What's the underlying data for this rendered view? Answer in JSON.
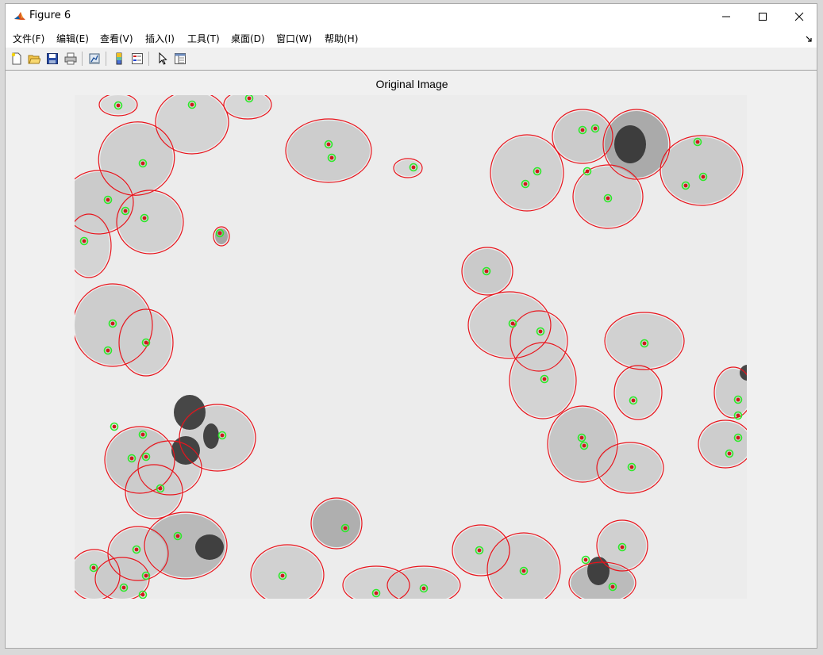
{
  "window": {
    "title": "Figure 6",
    "controls": {
      "minimize": "minimize-icon",
      "maximize": "maximize-icon",
      "close": "close-icon"
    }
  },
  "menu": [
    "文件(F)",
    "编辑(E)",
    "查看(V)",
    "插入(I)",
    "工具(T)",
    "桌面(D)",
    "窗口(W)",
    "帮助(H)"
  ],
  "toolbar": {
    "buttons": [
      "new-figure-icon",
      "open-file-icon",
      "save-icon",
      "print-icon",
      "link-plot-icon",
      "colorbar-icon",
      "legend-icon",
      "edit-plot-pointer-icon",
      "property-inspector-icon"
    ]
  },
  "figure": {
    "axes_title": "Original Image",
    "overlay_colors": {
      "cell_boundary": "#e8141c",
      "nucleus_boundary": "#2ee82a",
      "nucleus_fill": "#cc1a1a"
    }
  }
}
